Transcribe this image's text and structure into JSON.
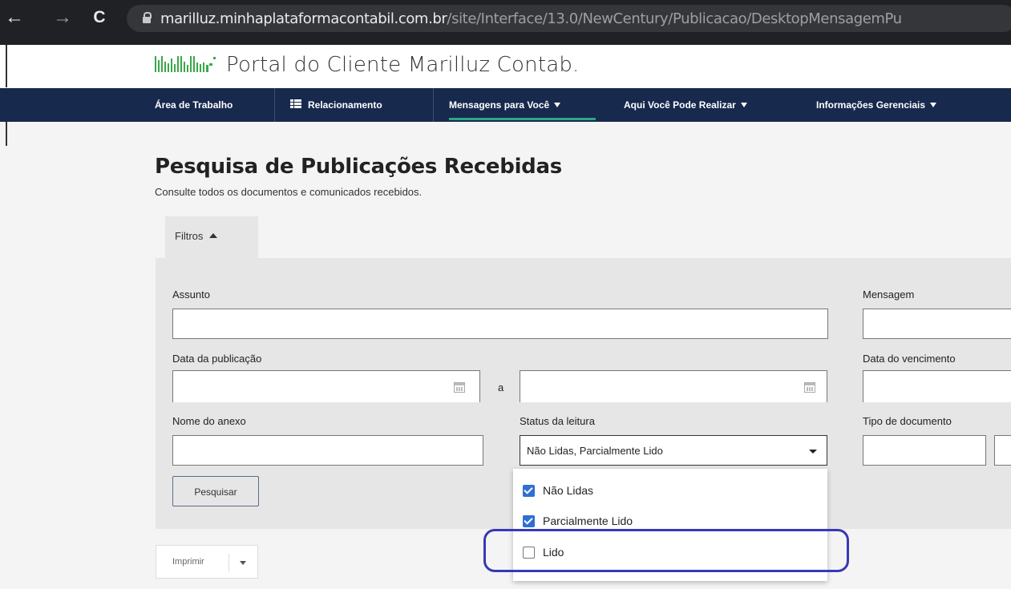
{
  "browser": {
    "url_host": "marilluz.minhaplataformacontabil.com.br",
    "url_path": "/site/Interface/13.0/NewCentury/Publicacao/DesktopMensagemPu",
    "back_glyph": "←",
    "forward_glyph": "→",
    "reload_glyph": "C"
  },
  "header": {
    "title": "Portal do Cliente Marilluz Contab."
  },
  "nav": {
    "items": [
      {
        "label": "Área de Trabalho"
      },
      {
        "label": "Relacionamento",
        "icon": "grid-icon"
      },
      {
        "label": "Mensagens para Você",
        "active": true
      },
      {
        "label": "Aqui Você Pode Realizar"
      },
      {
        "label": "Informações Gerenciais"
      }
    ]
  },
  "page": {
    "title": "Pesquisa de Publicações Recebidas",
    "subtitle": "Consulte todos os documentos e comunicados recebidos."
  },
  "filters": {
    "tab_label": "Filtros",
    "assunto_label": "Assunto",
    "assunto_value": "",
    "mensagem_label": "Mensagem",
    "data_publicacao_label": "Data da publicação",
    "range_separator": "a",
    "data_vencimento_label": "Data do vencimento",
    "nome_anexo_label": "Nome do anexo",
    "status_leitura_label": "Status da leitura",
    "status_leitura_value": "Não Lidas, Parcialmente Lido",
    "tipo_documento_label": "Tipo de documento",
    "search_button": "Pesquisar"
  },
  "status_options": [
    {
      "label": "Não Lidas",
      "checked": true
    },
    {
      "label": "Parcialmente Lido",
      "checked": true
    },
    {
      "label": "Lido",
      "checked": false
    }
  ],
  "print_button": {
    "label": "Imprimir"
  },
  "colors": {
    "nav_bg": "#17294d",
    "nav_active_underline": "#2aa58a",
    "checkbox_checked": "#2f6fd6",
    "highlight_outline": "#3838b8",
    "logo_green": "#3aa84a"
  }
}
